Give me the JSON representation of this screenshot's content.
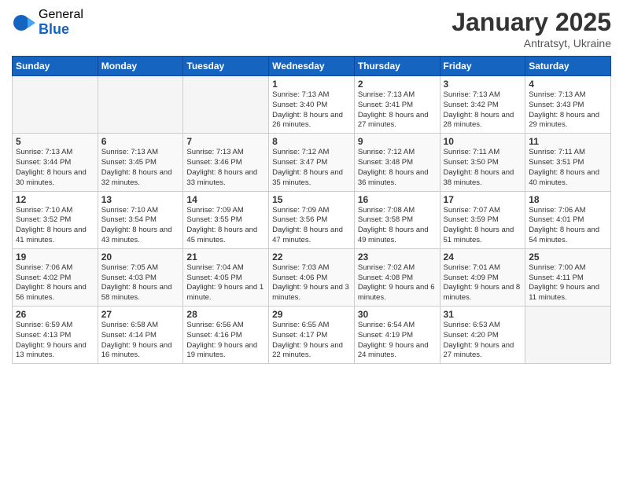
{
  "logo": {
    "general": "General",
    "blue": "Blue"
  },
  "header": {
    "month": "January 2025",
    "location": "Antratsyt, Ukraine"
  },
  "days_of_week": [
    "Sunday",
    "Monday",
    "Tuesday",
    "Wednesday",
    "Thursday",
    "Friday",
    "Saturday"
  ],
  "weeks": [
    [
      {
        "day": "",
        "empty": true
      },
      {
        "day": "",
        "empty": true
      },
      {
        "day": "",
        "empty": true
      },
      {
        "day": "1",
        "sunrise": "7:13 AM",
        "sunset": "3:40 PM",
        "daylight": "8 hours and 26 minutes."
      },
      {
        "day": "2",
        "sunrise": "7:13 AM",
        "sunset": "3:41 PM",
        "daylight": "8 hours and 27 minutes."
      },
      {
        "day": "3",
        "sunrise": "7:13 AM",
        "sunset": "3:42 PM",
        "daylight": "8 hours and 28 minutes."
      },
      {
        "day": "4",
        "sunrise": "7:13 AM",
        "sunset": "3:43 PM",
        "daylight": "8 hours and 29 minutes."
      }
    ],
    [
      {
        "day": "5",
        "sunrise": "7:13 AM",
        "sunset": "3:44 PM",
        "daylight": "8 hours and 30 minutes."
      },
      {
        "day": "6",
        "sunrise": "7:13 AM",
        "sunset": "3:45 PM",
        "daylight": "8 hours and 32 minutes."
      },
      {
        "day": "7",
        "sunrise": "7:13 AM",
        "sunset": "3:46 PM",
        "daylight": "8 hours and 33 minutes."
      },
      {
        "day": "8",
        "sunrise": "7:12 AM",
        "sunset": "3:47 PM",
        "daylight": "8 hours and 35 minutes."
      },
      {
        "day": "9",
        "sunrise": "7:12 AM",
        "sunset": "3:48 PM",
        "daylight": "8 hours and 36 minutes."
      },
      {
        "day": "10",
        "sunrise": "7:11 AM",
        "sunset": "3:50 PM",
        "daylight": "8 hours and 38 minutes."
      },
      {
        "day": "11",
        "sunrise": "7:11 AM",
        "sunset": "3:51 PM",
        "daylight": "8 hours and 40 minutes."
      }
    ],
    [
      {
        "day": "12",
        "sunrise": "7:10 AM",
        "sunset": "3:52 PM",
        "daylight": "8 hours and 41 minutes."
      },
      {
        "day": "13",
        "sunrise": "7:10 AM",
        "sunset": "3:54 PM",
        "daylight": "8 hours and 43 minutes."
      },
      {
        "day": "14",
        "sunrise": "7:09 AM",
        "sunset": "3:55 PM",
        "daylight": "8 hours and 45 minutes."
      },
      {
        "day": "15",
        "sunrise": "7:09 AM",
        "sunset": "3:56 PM",
        "daylight": "8 hours and 47 minutes."
      },
      {
        "day": "16",
        "sunrise": "7:08 AM",
        "sunset": "3:58 PM",
        "daylight": "8 hours and 49 minutes."
      },
      {
        "day": "17",
        "sunrise": "7:07 AM",
        "sunset": "3:59 PM",
        "daylight": "8 hours and 51 minutes."
      },
      {
        "day": "18",
        "sunrise": "7:06 AM",
        "sunset": "4:01 PM",
        "daylight": "8 hours and 54 minutes."
      }
    ],
    [
      {
        "day": "19",
        "sunrise": "7:06 AM",
        "sunset": "4:02 PM",
        "daylight": "8 hours and 56 minutes."
      },
      {
        "day": "20",
        "sunrise": "7:05 AM",
        "sunset": "4:03 PM",
        "daylight": "8 hours and 58 minutes."
      },
      {
        "day": "21",
        "sunrise": "7:04 AM",
        "sunset": "4:05 PM",
        "daylight": "9 hours and 1 minute."
      },
      {
        "day": "22",
        "sunrise": "7:03 AM",
        "sunset": "4:06 PM",
        "daylight": "9 hours and 3 minutes."
      },
      {
        "day": "23",
        "sunrise": "7:02 AM",
        "sunset": "4:08 PM",
        "daylight": "9 hours and 6 minutes."
      },
      {
        "day": "24",
        "sunrise": "7:01 AM",
        "sunset": "4:09 PM",
        "daylight": "9 hours and 8 minutes."
      },
      {
        "day": "25",
        "sunrise": "7:00 AM",
        "sunset": "4:11 PM",
        "daylight": "9 hours and 11 minutes."
      }
    ],
    [
      {
        "day": "26",
        "sunrise": "6:59 AM",
        "sunset": "4:13 PM",
        "daylight": "9 hours and 13 minutes."
      },
      {
        "day": "27",
        "sunrise": "6:58 AM",
        "sunset": "4:14 PM",
        "daylight": "9 hours and 16 minutes."
      },
      {
        "day": "28",
        "sunrise": "6:56 AM",
        "sunset": "4:16 PM",
        "daylight": "9 hours and 19 minutes."
      },
      {
        "day": "29",
        "sunrise": "6:55 AM",
        "sunset": "4:17 PM",
        "daylight": "9 hours and 22 minutes."
      },
      {
        "day": "30",
        "sunrise": "6:54 AM",
        "sunset": "4:19 PM",
        "daylight": "9 hours and 24 minutes."
      },
      {
        "day": "31",
        "sunrise": "6:53 AM",
        "sunset": "4:20 PM",
        "daylight": "9 hours and 27 minutes."
      },
      {
        "day": "",
        "empty": true
      }
    ]
  ]
}
